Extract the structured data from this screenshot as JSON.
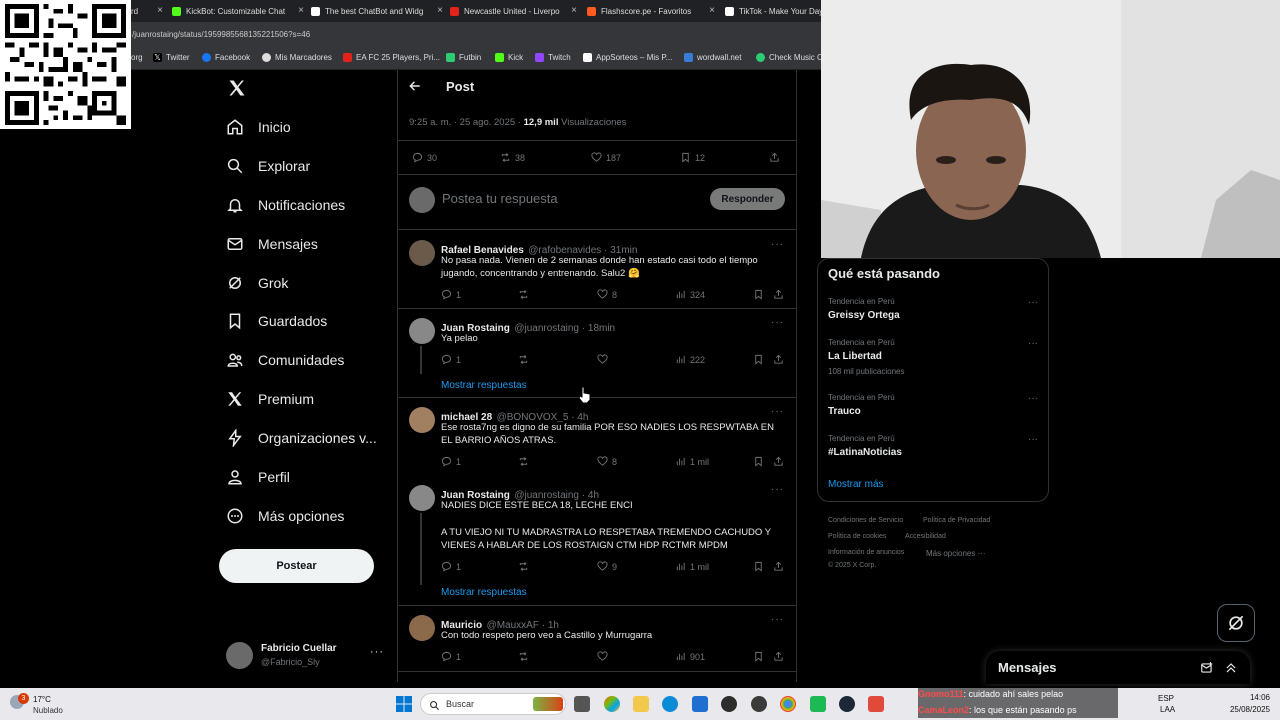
{
  "tabs": [
    {
      "label": "rd",
      "color": "#888"
    },
    {
      "label": "KickBot: Customizable Chat",
      "color": "#53fc18"
    },
    {
      "label": "The best ChatBot and Widg",
      "color": "#ffffff"
    },
    {
      "label": "Newcastle United - Liverpo",
      "color": "#e2231a"
    },
    {
      "label": "Flashscore.pe - Favoritos",
      "color": "#ff5a1f"
    },
    {
      "label": "TikTok - Make Your Day",
      "color": "#ffffff"
    }
  ],
  "url": "/juanrostaing/status/1959985568135221506?s=46",
  "bookmarks": [
    {
      "label": "org",
      "color": "#888"
    },
    {
      "label": "Twitter",
      "color": "#ffffff"
    },
    {
      "label": "Facebook",
      "color": "#1877f2"
    },
    {
      "label": "Mis Marcadores",
      "color": "#dddddd"
    },
    {
      "label": "EA FC 25 Players, Pri...",
      "color": "#e2231a"
    },
    {
      "label": "Futbin",
      "color": "#2ecc71"
    },
    {
      "label": "Kick",
      "color": "#53fc18"
    },
    {
      "label": "Twitch",
      "color": "#9146ff"
    },
    {
      "label": "AppSorteos – Mis P...",
      "color": "#ffffff"
    },
    {
      "label": "wordwall.net",
      "color": "#3a7bd5"
    },
    {
      "label": "Check Music C",
      "color": "#2ecc71"
    }
  ],
  "nav": {
    "home": "Inicio",
    "explore": "Explorar",
    "notifications": "Notificaciones",
    "messages": "Mensajes",
    "grok": "Grok",
    "bookmarks": "Guardados",
    "communities": "Comunidades",
    "premium": "Premium",
    "organizations": "Organizaciones v...",
    "profile": "Perfil",
    "more": "Más opciones",
    "post_button": "Postear"
  },
  "account": {
    "name": "Fabricio Cuellar",
    "handle": "@Fabricio_Sly"
  },
  "post_header": {
    "title": "Post"
  },
  "post_meta": {
    "time": "9:25 a. m. · 25 ago. 2025 · ",
    "views": "12,9 mil",
    "views_label": "Visualizaciones"
  },
  "post_stats": {
    "replies": "30",
    "reposts": "38",
    "likes": "187",
    "bookmarks": "12"
  },
  "reply_box": {
    "placeholder": "Postea tu respuesta",
    "button": "Responder"
  },
  "replies": [
    {
      "name": "Rafael Benavides",
      "handle": "@rafobenavides · 31min",
      "text": "No pasa nada. Vienen de 2 semanas donde han estado casi todo el tiempo jugando, concentrando y entrenando. Salu2 🤗",
      "replies": "1",
      "likes": "8",
      "views": "324",
      "avatar_color": "#6b5a4a"
    },
    {
      "name": "Juan Rostaing",
      "handle": "@juanrostaing · 18min",
      "text": "Ya pelao",
      "replies": "1",
      "likes": "",
      "views": "222",
      "avatar_color": "#888888",
      "show_replies": "Mostrar respuestas"
    },
    {
      "name": "michael 28",
      "handle": "@BONOVOX_5 · 4h",
      "text": "Ese rosta7ng es digno de su familia POR ESO NADIES LOS RESPWTABA EN EL BARRIO AÑOS ATRAS.",
      "replies": "1",
      "likes": "8",
      "views": "1 mil",
      "avatar_color": "#a08060"
    },
    {
      "name": "Juan Rostaing",
      "handle": "@juanrostaing · 4h",
      "text": "NADIES DICE ESTE BECA 18, LECHE ENCI",
      "text2": "A TU VIEJO NI TU MADRASTRA LO RESPETABA TREMENDO CACHUDO Y VIENES A HABLAR DE LOS ROSTAIGN CTM HDP RCTMR MPDM",
      "replies": "1",
      "likes": "9",
      "views": "1 mil",
      "avatar_color": "#888888",
      "show_replies": "Mostrar respuestas"
    },
    {
      "name": "Mauricio",
      "handle": "@MauxxAF · 1h",
      "text": "Con todo respeto pero veo a Castillo y Murrugarra",
      "replies": "1",
      "likes": "",
      "views": "901",
      "avatar_color": "#8a6a4a"
    }
  ],
  "trends": {
    "title": "Qué está pasando",
    "items": [
      {
        "category": "Tendencia en Perú",
        "name": "Greissy Ortega",
        "count": ""
      },
      {
        "category": "Tendencia en Perú",
        "name": "La Libertad",
        "count": "108 mil publicaciones"
      },
      {
        "category": "Tendencia en Perú",
        "name": "Trauco",
        "count": ""
      },
      {
        "category": "Tendencia en Perú",
        "name": "#LatinaNoticias",
        "count": ""
      }
    ],
    "show_more": "Mostrar más"
  },
  "footer": {
    "terms": "Condiciones de Servicio",
    "privacy": "Política de Privacidad",
    "cookies": "Política de cookies",
    "accessibility": "Accesibilidad",
    "ads": "Información de anuncios",
    "more": "Más opciones ···",
    "copyright": "© 2025 X Corp."
  },
  "messages_bar": {
    "title": "Mensajes"
  },
  "chat_overlay": [
    {
      "user": "Gnomo111",
      "text": ": cuidado ahí sales pelao"
    },
    {
      "user": "CamaLeon2",
      "text": ": los que están pasando ps"
    }
  ],
  "taskbar": {
    "weather_temp": "17°C",
    "weather_desc": "Nublado",
    "weather_badge": "3",
    "search": "Buscar",
    "lang": "ESP",
    "lang2": "LAA",
    "time": "14:06",
    "date": "25/08/2025"
  }
}
